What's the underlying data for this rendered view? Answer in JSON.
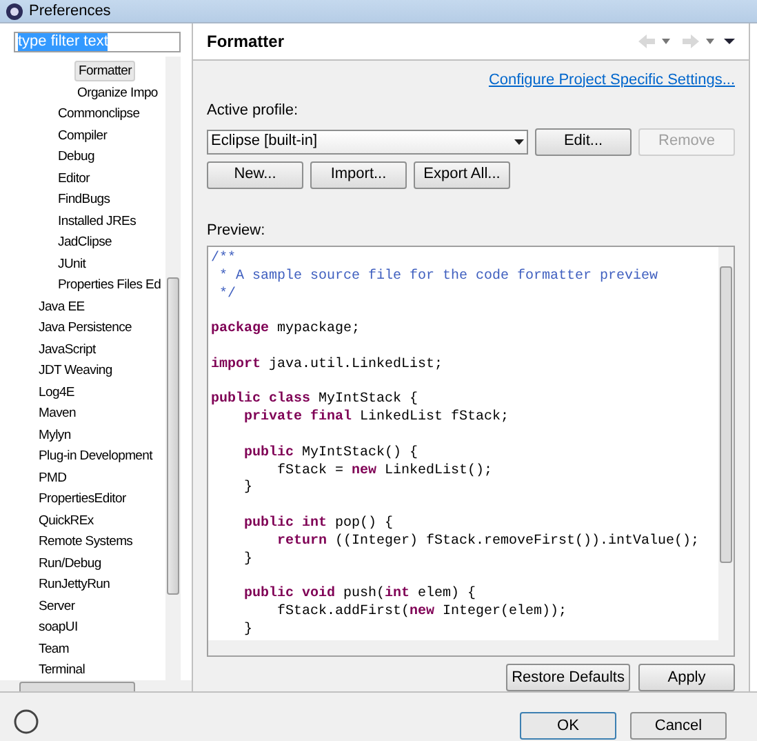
{
  "window": {
    "title": "Preferences"
  },
  "filter": {
    "value": "type filter text"
  },
  "tree": {
    "items": [
      {
        "children": [
          {
            "children": [
              {
                "label": "Formatter",
                "selected": true
              },
              {
                "label": "Organize Impo",
                "selected": false
              }
            ]
          },
          {
            "label": "Commonclipse",
            "selected": false
          },
          {
            "label": "Compiler",
            "selected": false
          },
          {
            "label": "Debug",
            "selected": false
          },
          {
            "label": "Editor",
            "selected": false
          },
          {
            "label": "FindBugs",
            "selected": false
          },
          {
            "label": "Installed JREs",
            "selected": false
          },
          {
            "label": "JadClipse",
            "selected": false
          },
          {
            "label": "JUnit",
            "selected": false
          },
          {
            "label": "Properties Files Ed",
            "selected": false
          }
        ]
      },
      {
        "label": "Java EE",
        "selected": false
      },
      {
        "label": "Java Persistence",
        "selected": false
      },
      {
        "label": "JavaScript",
        "selected": false
      },
      {
        "label": "JDT Weaving",
        "selected": false
      },
      {
        "label": "Log4E",
        "selected": false
      },
      {
        "label": "Maven",
        "selected": false
      },
      {
        "label": "Mylyn",
        "selected": false
      },
      {
        "label": "Plug-in Development",
        "selected": false
      },
      {
        "label": "PMD",
        "selected": false
      },
      {
        "label": "PropertiesEditor",
        "selected": false
      },
      {
        "label": "QuickREx",
        "selected": false
      },
      {
        "label": "Remote Systems",
        "selected": false
      },
      {
        "label": "Run/Debug",
        "selected": false
      },
      {
        "label": "RunJettyRun",
        "selected": false
      },
      {
        "label": "Server",
        "selected": false
      },
      {
        "label": "soapUI",
        "selected": false
      },
      {
        "label": "Team",
        "selected": false
      },
      {
        "label": "Terminal",
        "selected": false
      }
    ]
  },
  "page": {
    "title": "Formatter",
    "link": "Configure Project Specific Settings...",
    "profile_label": "Active profile:",
    "profile_value": "Eclipse [built-in]",
    "buttons_row1": [
      {
        "label": "Edit...",
        "disabled": false
      },
      {
        "label": "Remove",
        "disabled": true
      }
    ],
    "buttons_row2": [
      {
        "label": "New...",
        "disabled": false
      },
      {
        "label": "Import...",
        "disabled": false
      },
      {
        "label": "Export All...",
        "disabled": false
      }
    ],
    "preview_label": "Preview:",
    "code": [
      [
        {
          "kind": "comment",
          "text": "/**"
        }
      ],
      [
        {
          "kind": "comment",
          "text": " * A sample source file for the code formatter preview"
        }
      ],
      [
        {
          "kind": "comment",
          "text": " */"
        }
      ],
      [
        {
          "kind": "blank"
        }
      ],
      [
        {
          "kind": "keyword",
          "text": "package"
        },
        {
          "kind": "plain",
          "text": " mypackage;"
        }
      ],
      [
        {
          "kind": "blank"
        }
      ],
      [
        {
          "kind": "keyword",
          "text": "import"
        },
        {
          "kind": "plain",
          "text": " java.util.LinkedList;"
        }
      ],
      [
        {
          "kind": "blank"
        }
      ],
      [
        {
          "kind": "keyword",
          "text": "public class"
        },
        {
          "kind": "plain",
          "text": " MyIntStack {"
        }
      ],
      [
        {
          "kind": "keyword",
          "text": "    private final"
        },
        {
          "kind": "plain",
          "text": " LinkedList fStack;"
        }
      ],
      [
        {
          "kind": "blank"
        }
      ],
      [
        {
          "kind": "keyword",
          "text": "    public"
        },
        {
          "kind": "plain",
          "text": " MyIntStack() {"
        }
      ],
      [
        {
          "kind": "plain",
          "text": "        fStack = "
        },
        {
          "kind": "keyword",
          "text": "new"
        },
        {
          "kind": "plain",
          "text": " LinkedList();"
        }
      ],
      [
        {
          "kind": "plain",
          "text": "    }"
        }
      ],
      [
        {
          "kind": "blank"
        }
      ],
      [
        {
          "kind": "keyword",
          "text": "    public int"
        },
        {
          "kind": "plain",
          "text": " pop() {"
        }
      ],
      [
        {
          "kind": "keyword",
          "text": "        return"
        },
        {
          "kind": "plain",
          "text": " ((Integer) fStack.removeFirst()).intValue();"
        }
      ],
      [
        {
          "kind": "plain",
          "text": "    }"
        }
      ],
      [
        {
          "kind": "blank"
        }
      ],
      [
        {
          "kind": "keyword",
          "text": "    public void"
        },
        {
          "kind": "plain",
          "text": " push("
        },
        {
          "kind": "keyword",
          "text": "int"
        },
        {
          "kind": "plain",
          "text": " elem) {"
        }
      ],
      [
        {
          "kind": "plain",
          "text": "        fStack.addFirst("
        },
        {
          "kind": "keyword",
          "text": "new"
        },
        {
          "kind": "plain",
          "text": " Integer(elem));"
        }
      ],
      [
        {
          "kind": "plain",
          "text": "    }"
        }
      ]
    ],
    "bottom_buttons": [
      {
        "label": "Restore Defaults"
      },
      {
        "label": "Apply"
      }
    ]
  },
  "dialog_buttons": [
    {
      "label": "OK",
      "default": true
    },
    {
      "label": "Cancel",
      "default": false
    }
  ]
}
